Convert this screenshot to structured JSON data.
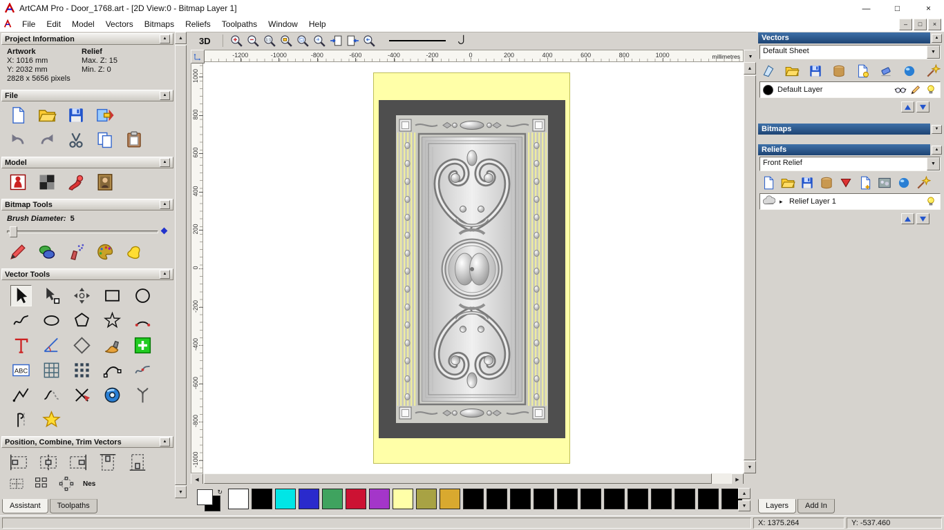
{
  "window": {
    "title": "ArtCAM Pro - Door_1768.art - [2D View:0 - Bitmap Layer 1]"
  },
  "menu": {
    "items": [
      "File",
      "Edit",
      "Model",
      "Vectors",
      "Bitmaps",
      "Reliefs",
      "Toolpaths",
      "Window",
      "Help"
    ]
  },
  "assistant": {
    "project_information": {
      "title": "Project Information",
      "artwork_label": "Artwork",
      "relief_label": "Relief",
      "artwork_x": "X: 1016 mm",
      "artwork_y": "Y: 2032 mm",
      "relief_max_z": "Max. Z: 15",
      "relief_min_z": "Min. Z: 0",
      "pixel_size": "2828 x 5656 pixels"
    },
    "sections": {
      "file": "File",
      "model": "Model",
      "bitmap_tools": "Bitmap Tools",
      "vector_tools": "Vector Tools",
      "position_combine_trim": "Position, Combine, Trim Vectors"
    },
    "brush": {
      "label": "Brush Diameter:",
      "value": "5"
    },
    "file_icons_row1": [
      "new-model-icon",
      "open-file-icon",
      "save-file-icon",
      "export-3d-icon"
    ],
    "file_icons_row2": [
      "undo-icon",
      "redo-icon",
      "cut-icon",
      "copy-icon",
      "paste-icon"
    ],
    "model_icons": [
      "load-relief-icon",
      "invert-model-icon",
      "sculpt-icon",
      "load-image-icon"
    ],
    "bitmap_icons": [
      "paint-icon",
      "paint-selective-icon",
      "spray-icon",
      "palette-icon",
      "colour-blend-icon"
    ],
    "vector_icons": [
      "select-vectors-icon",
      "node-editing-icon",
      "transform-vectors-icon",
      "create-rectangle-icon",
      "create-circle-icon",
      "create-freehand-icon",
      "create-ellipse-icon",
      "create-polygon-icon",
      "create-star-icon",
      "create-arc-icon",
      "create-text-icon",
      "measure-icon",
      "create-diamond-icon",
      "paint-vector-icon",
      "snap-grid-icon",
      "wrap-text-icon",
      "paste-grid-icon",
      "block-copy-icon",
      "fit-curve-icon",
      "fit-arcs-icon",
      "create-polyline-icon",
      "join-vectors-icon",
      "trim-vectors-icon",
      "create-doughnut-icon",
      "fillet-icon",
      "mirror-vectors-icon",
      "vector-doctor-icon"
    ],
    "position_icons": [
      "align-left-icon",
      "align-centre-icon",
      "align-right-icon",
      "align-top-icon",
      "align-bottom-icon"
    ],
    "position_icons_row2": [
      "centre-in-page-icon",
      "block-array-icon",
      "rotate-array-icon"
    ],
    "nest_label": "Nes",
    "tabs": [
      {
        "label": "Assistant"
      },
      {
        "label": "Toolpaths"
      }
    ]
  },
  "canvas": {
    "toolbar": {
      "three_d_label": "3D",
      "icons": [
        "zoom-in-icon",
        "zoom-out-icon",
        "zoom-scale-icon",
        "zoom-object-icon",
        "zoom-fit-icon",
        "zoom-drag-icon",
        "snap-page-left-icon",
        "snap-page-right-icon",
        "zoom-previous-icon"
      ]
    },
    "ruler_unit": "millimetres",
    "h_ticks": [
      -1200,
      -1000,
      -800,
      -600,
      -400,
      -200,
      0,
      200,
      400,
      600,
      800,
      1000
    ],
    "v_ticks": [
      1000,
      800,
      600,
      400,
      200,
      0,
      -200,
      -400,
      -600,
      -800,
      -1000
    ]
  },
  "layers_panel": {
    "vectors": {
      "title": "Vectors",
      "sheet": "Default Sheet",
      "toolbar_icons": [
        "new-sheet-icon",
        "open-vectors-icon",
        "save-vectors-icon",
        "merge-layers-icon",
        "new-layer-icon",
        "delete-layer-icon",
        "snap-sphere-icon",
        "toggle-all-icon"
      ],
      "layer": {
        "name": "Default Layer",
        "icons": [
          "visibility-glasses-icon",
          "edit-pen-icon",
          "lightbulb-icon"
        ]
      }
    },
    "bitmaps": {
      "title": "Bitmaps"
    },
    "reliefs": {
      "title": "Reliefs",
      "relief": "Front Relief",
      "toolbar_icons": [
        "new-relief-icon",
        "open-relief-icon",
        "save-relief-icon",
        "merge-relief-icon",
        "delete-relief-icon",
        "new-relief-layer-icon",
        "texture-relief-icon",
        "relief-sphere-icon",
        "relief-wand-icon"
      ],
      "layer": {
        "name": "Relief Layer 1",
        "icons_left": [
          "relief-thumb-icon"
        ],
        "icons_right": [
          "lightbulb-icon"
        ]
      }
    },
    "tabs": [
      {
        "label": "Layers"
      },
      {
        "label": "Add In"
      }
    ]
  },
  "palette": {
    "colors": [
      "#ffffff",
      "#000000",
      "#00e6e6",
      "#2a2acc",
      "#3fa35f",
      "#cc1233",
      "#a436c9",
      "#ffffa8",
      "#a8a244",
      "#d9a92f",
      "#000000",
      "#000000",
      "#000000",
      "#000000",
      "#000000",
      "#000000",
      "#000000",
      "#000000",
      "#000000",
      "#000000",
      "#000000",
      "#000000"
    ]
  },
  "status_bar": {
    "x_coord": "X: 1375.264",
    "y_coord": "Y: -537.460"
  }
}
